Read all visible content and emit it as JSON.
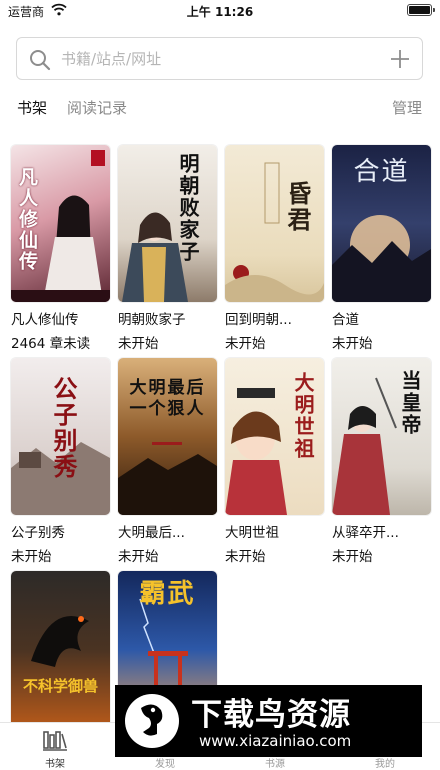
{
  "status_bar": {
    "carrier": "运营商",
    "time": "上午 11:26"
  },
  "search": {
    "placeholder": "书籍/站点/网址"
  },
  "tabs": [
    {
      "label": "书架",
      "active": true
    },
    {
      "label": "阅读记录",
      "active": false
    }
  ],
  "manage_label": "管理",
  "books": [
    {
      "title": "凡人修仙传",
      "status": "2464 章未读",
      "cover_text": "凡人修仙传",
      "cover_color": "#b8324a"
    },
    {
      "title": "明朝败家子",
      "status": "未开始",
      "cover_text": "明朝败家子",
      "cover_color": "#e9e3da"
    },
    {
      "title": "回到明朝...",
      "status": "未开始",
      "cover_text": "昏君",
      "cover_color": "#efe4cb"
    },
    {
      "title": "合道",
      "status": "未开始",
      "cover_text": "合道",
      "cover_color": "#26325a"
    },
    {
      "title": "公子别秀",
      "status": "未开始",
      "cover_text": "公子别秀",
      "cover_color": "#e4dad6"
    },
    {
      "title": "大明最后...",
      "status": "未开始",
      "cover_text": "大明最后一个狠人",
      "cover_color": "#3b2514"
    },
    {
      "title": "大明世祖",
      "status": "未开始",
      "cover_text": "大明世祖",
      "cover_color": "#f1ead9"
    },
    {
      "title": "从驿卒开...",
      "status": "未开始",
      "cover_text": "当皇帝",
      "cover_color": "#e8e4dc"
    },
    {
      "cover_text": "不科学御兽",
      "cover_color": "#1f1b1a"
    },
    {
      "cover_text": "霸武",
      "cover_color": "#1e3a78"
    }
  ],
  "bottom_nav": [
    {
      "label": "书架",
      "icon": "bookshelf-icon",
      "active": true
    },
    {
      "label": "发现",
      "icon": "compass-icon",
      "active": false
    },
    {
      "label": "书源",
      "icon": "source-icon",
      "active": false
    },
    {
      "label": "我的",
      "icon": "profile-icon",
      "active": false
    }
  ],
  "watermark": {
    "title": "下载鸟资源",
    "url": "www.xiazainiao.com"
  }
}
